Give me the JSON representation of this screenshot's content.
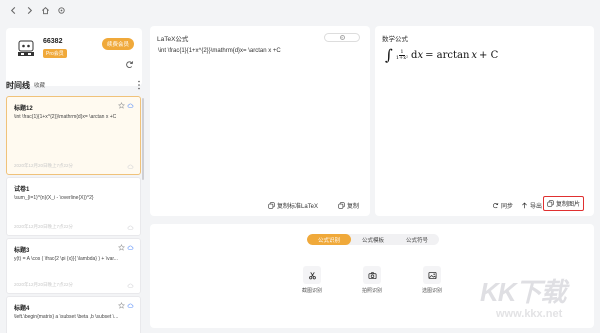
{
  "titlebar": {
    "icons": [
      "chevron-left-icon",
      "chevron-right-icon",
      "home-icon",
      "settings-icon"
    ]
  },
  "profile": {
    "user_id": "66382",
    "vip_tag": "Pro会员",
    "upgrade_label": "续费会员"
  },
  "timeline": {
    "title": "时间线",
    "collect_label": "收藏",
    "items": [
      {
        "title": "标题12",
        "code": "\\int \\frac{1}{1+x^{2}}\\mathrm{d}x= \\arctan x +C",
        "date": "2020年12月20日晚上7点22分"
      },
      {
        "title": "试卷1",
        "code": "\\sum_{i=1}^{n}(X_i - \\overline{X})^2}",
        "date": "2020年12月20日晚上7点22分"
      },
      {
        "title": "标题3",
        "code": "y(t) = A \\cos ( \\frac{2 \\pi {x}}{ \\lambda} ) + \\var...",
        "date": "2020年12月20日晚上7点22分"
      },
      {
        "title": "标题4",
        "code": "\\left.\\begin{matrix} a \\subset \\beta ,b \\subset \\...",
        "date": ""
      }
    ]
  },
  "latex_panel": {
    "title": "LaTeX公式",
    "content": "\\int \\frac{1}{1+x^{2}}\\mathrm{d}x= \\arctan x +C",
    "copy_standard_label": "复制标准LaTeX",
    "copy_label": "复制"
  },
  "math_panel": {
    "title": "数学公式",
    "formula_tail": "= arctan",
    "formula_end": "+ C",
    "sync_label": "同步",
    "export_label": "导出",
    "copy_image_label": "复制图片"
  },
  "bottom_panel": {
    "tabs": [
      {
        "label": "公式识别",
        "active": true
      },
      {
        "label": "公式模板",
        "active": false
      },
      {
        "label": "公式符号",
        "active": false
      }
    ],
    "tools": [
      {
        "label": "截图识别",
        "icon": "scissors-icon"
      },
      {
        "label": "拍照识别",
        "icon": "camera-icon"
      },
      {
        "label": "选图识别",
        "icon": "image-icon"
      }
    ]
  },
  "watermark": {
    "text": "KK下载",
    "url": "www.kkx.net"
  },
  "colors": {
    "accent": "#f0a93a",
    "highlight": "#e03030",
    "cloud": "#5b8ff9"
  }
}
